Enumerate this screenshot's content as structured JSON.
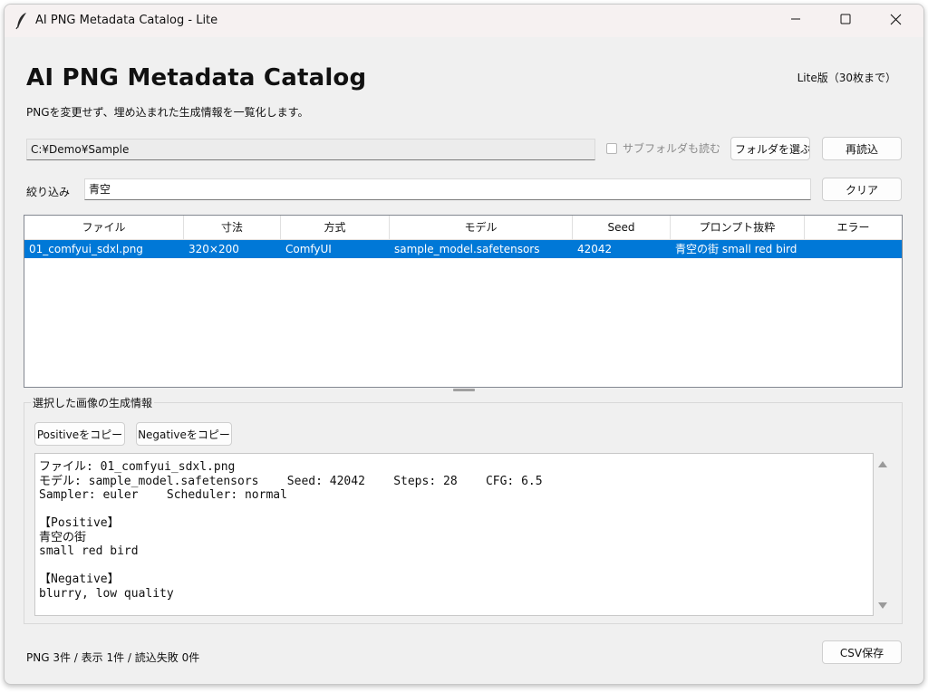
{
  "window": {
    "title": "AI PNG Metadata Catalog - Lite",
    "icon": "quill-feather-icon",
    "controls": [
      "minimize-icon",
      "maximize-icon",
      "close-icon"
    ]
  },
  "header": {
    "title": "AI PNG Metadata Catalog",
    "subtitle": "PNGを変更せず、埋め込まれた生成情報を一覧化します。",
    "edition": "Lite版（30枚まで）"
  },
  "folder": {
    "path": "C:¥Demo¥Sample",
    "subfolder_label": "サブフォルダも読む",
    "subfolder_checked": false,
    "choose_button": "フォルダを選ぶ",
    "reload_button": "再読込"
  },
  "filter": {
    "label": "絞り込み",
    "value": "青空",
    "clear_button": "クリア"
  },
  "table": {
    "columns": [
      "ファイル",
      "寸法",
      "方式",
      "モデル",
      "Seed",
      "プロンプト抜粋",
      "エラー"
    ],
    "rows": [
      {
        "file": "01_comfyui_sdxl.png",
        "size": "320×200",
        "method": "ComfyUI",
        "model": "sample_model.safetensors",
        "seed": "42042",
        "prompt": "青空の街 small red bird",
        "error": "",
        "selected": true
      }
    ]
  },
  "detail": {
    "group_label": "選択した画像の生成情報",
    "copy_positive": "Positiveをコピー",
    "copy_negative": "Negativeをコピー",
    "lines": [
      "ファイル: 01_comfyui_sdxl.png",
      "モデル: sample_model.safetensors    Seed: 42042    Steps: 28    CFG: 6.5",
      "Sampler: euler    Scheduler: normal",
      "",
      "【Positive】",
      "青空の街",
      "small red bird",
      "",
      "【Negative】",
      "blurry, low quality"
    ]
  },
  "footer": {
    "status": "PNG 3件 / 表示 1件 / 読込失敗 0件",
    "csv_button": "CSV保存"
  },
  "colors": {
    "selection": "#0078d7",
    "window_bg": "#f0f0f0",
    "titlebar_bg": "#f6f1f1"
  }
}
